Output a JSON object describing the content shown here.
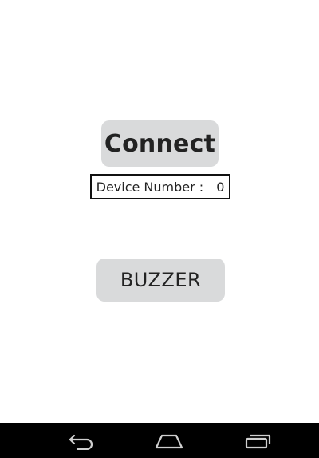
{
  "main": {
    "connect_label": "Connect",
    "device_label": "Device Number :",
    "device_value": "0",
    "buzzer_label": "BUZZER"
  },
  "navbar": {
    "back_icon": "back-icon",
    "home_icon": "home-icon",
    "recents_icon": "recents-icon"
  },
  "colors": {
    "button_bg": "#d9dadb",
    "nav_bg": "#000000",
    "text": "#222222"
  }
}
